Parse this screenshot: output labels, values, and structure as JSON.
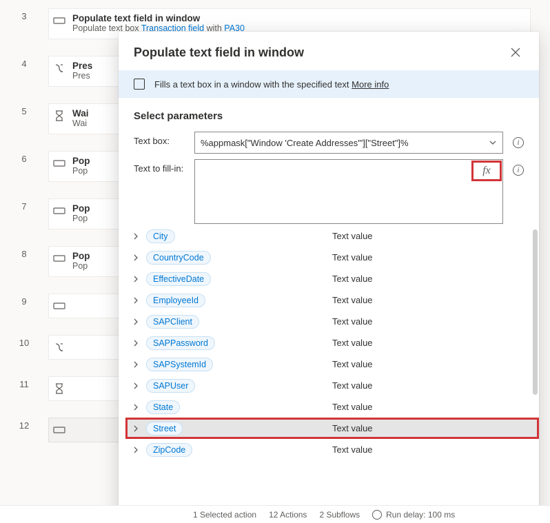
{
  "steps": [
    {
      "num": "3",
      "icon": "textbox",
      "title": "Populate text field in window",
      "sub_pre": "Populate text box ",
      "sub_link1": "Transaction field",
      "sub_mid": " with ",
      "sub_link2": "PA30"
    },
    {
      "num": "4",
      "icon": "keypress",
      "title": "Pres",
      "sub_pre": "Pres"
    },
    {
      "num": "5",
      "icon": "wait",
      "title": "Wai",
      "sub_pre": "Wai"
    },
    {
      "num": "6",
      "icon": "textbox",
      "title": "Pop",
      "sub_pre": "Pop"
    },
    {
      "num": "7",
      "icon": "textbox",
      "title": "Pop",
      "sub_pre": "Pop"
    },
    {
      "num": "8",
      "icon": "textbox",
      "title": "Pop",
      "sub_pre": "Pop"
    },
    {
      "num": "9",
      "icon": "textbox",
      "title": "",
      "sub_pre": ""
    },
    {
      "num": "10",
      "icon": "keypress",
      "title": "",
      "sub_pre": ""
    },
    {
      "num": "11",
      "icon": "wait",
      "title": "",
      "sub_pre": ""
    },
    {
      "num": "12",
      "icon": "textbox",
      "title": "",
      "sub_pre": "",
      "selected": true
    }
  ],
  "modal": {
    "title": "Populate text field in window",
    "banner_text": "Fills a text box in a window with the specified text ",
    "banner_link": "More info",
    "section": "Select parameters",
    "label_textbox": "Text box:",
    "label_fill": "Text to fill-in:",
    "textbox_value": "%appmask[\"Window 'Create Addresses'\"][\"Street\"]%",
    "fill_value": "",
    "fx_label": "fx"
  },
  "variables": [
    {
      "name": "City",
      "type": "Text value"
    },
    {
      "name": "CountryCode",
      "type": "Text value"
    },
    {
      "name": "EffectiveDate",
      "type": "Text value"
    },
    {
      "name": "EmployeeId",
      "type": "Text value"
    },
    {
      "name": "SAPClient",
      "type": "Text value"
    },
    {
      "name": "SAPPassword",
      "type": "Text value"
    },
    {
      "name": "SAPSystemId",
      "type": "Text value"
    },
    {
      "name": "SAPUser",
      "type": "Text value"
    },
    {
      "name": "State",
      "type": "Text value"
    },
    {
      "name": "Street",
      "type": "Text value",
      "highlighted": true,
      "selected": true
    },
    {
      "name": "ZipCode",
      "type": "Text value"
    }
  ],
  "status": {
    "sel": "1 Selected action",
    "actions": "12 Actions",
    "subflows": "2 Subflows",
    "delay": "Run delay: 100 ms"
  }
}
